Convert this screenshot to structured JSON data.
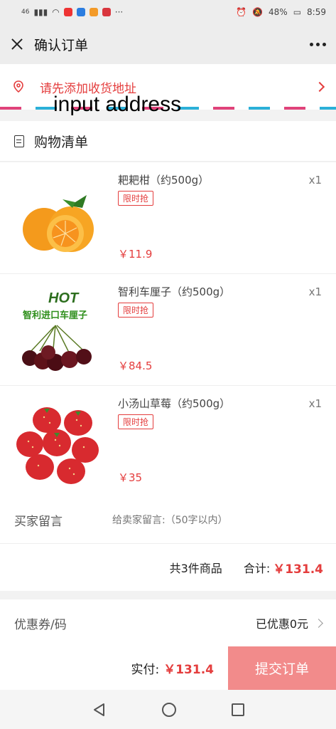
{
  "status_bar": {
    "signal": "46",
    "battery": "48%",
    "time": "8:59",
    "more": "···"
  },
  "header": {
    "title": "确认订单"
  },
  "address": {
    "prompt": "请先添加收货地址",
    "overlay_label": "input address"
  },
  "cart": {
    "title": "购物清单",
    "items": [
      {
        "name": "耙耙柑（约500g）",
        "qty": "x1",
        "tag": "限时抢",
        "price": "￥11.9",
        "image": "orange-fruit"
      },
      {
        "name": "智利车厘子（约500g）",
        "qty": "x1",
        "tag": "限时抢",
        "price": "￥84.5",
        "image": "cherries",
        "image_text": {
          "hot": "HOT",
          "title": "智利进口车厘子"
        }
      },
      {
        "name": "小汤山草莓（约500g）",
        "qty": "x1",
        "tag": "限时抢",
        "price": "￥35",
        "image": "strawberries"
      }
    ]
  },
  "message": {
    "label": "买家留言",
    "placeholder": "给卖家留言:（50字以内）"
  },
  "summary": {
    "count_text": "共3件商品",
    "total_label": "合计:",
    "total_amount": "￥131.4"
  },
  "coupon": {
    "label": "优惠券/码",
    "value": "已优惠0元"
  },
  "footer": {
    "pay_label": "实付:",
    "pay_amount": "￥131.4",
    "submit_label": "提交订单"
  },
  "colors": {
    "accent": "#e43d3d",
    "submit_bg": "#f28b8b"
  }
}
